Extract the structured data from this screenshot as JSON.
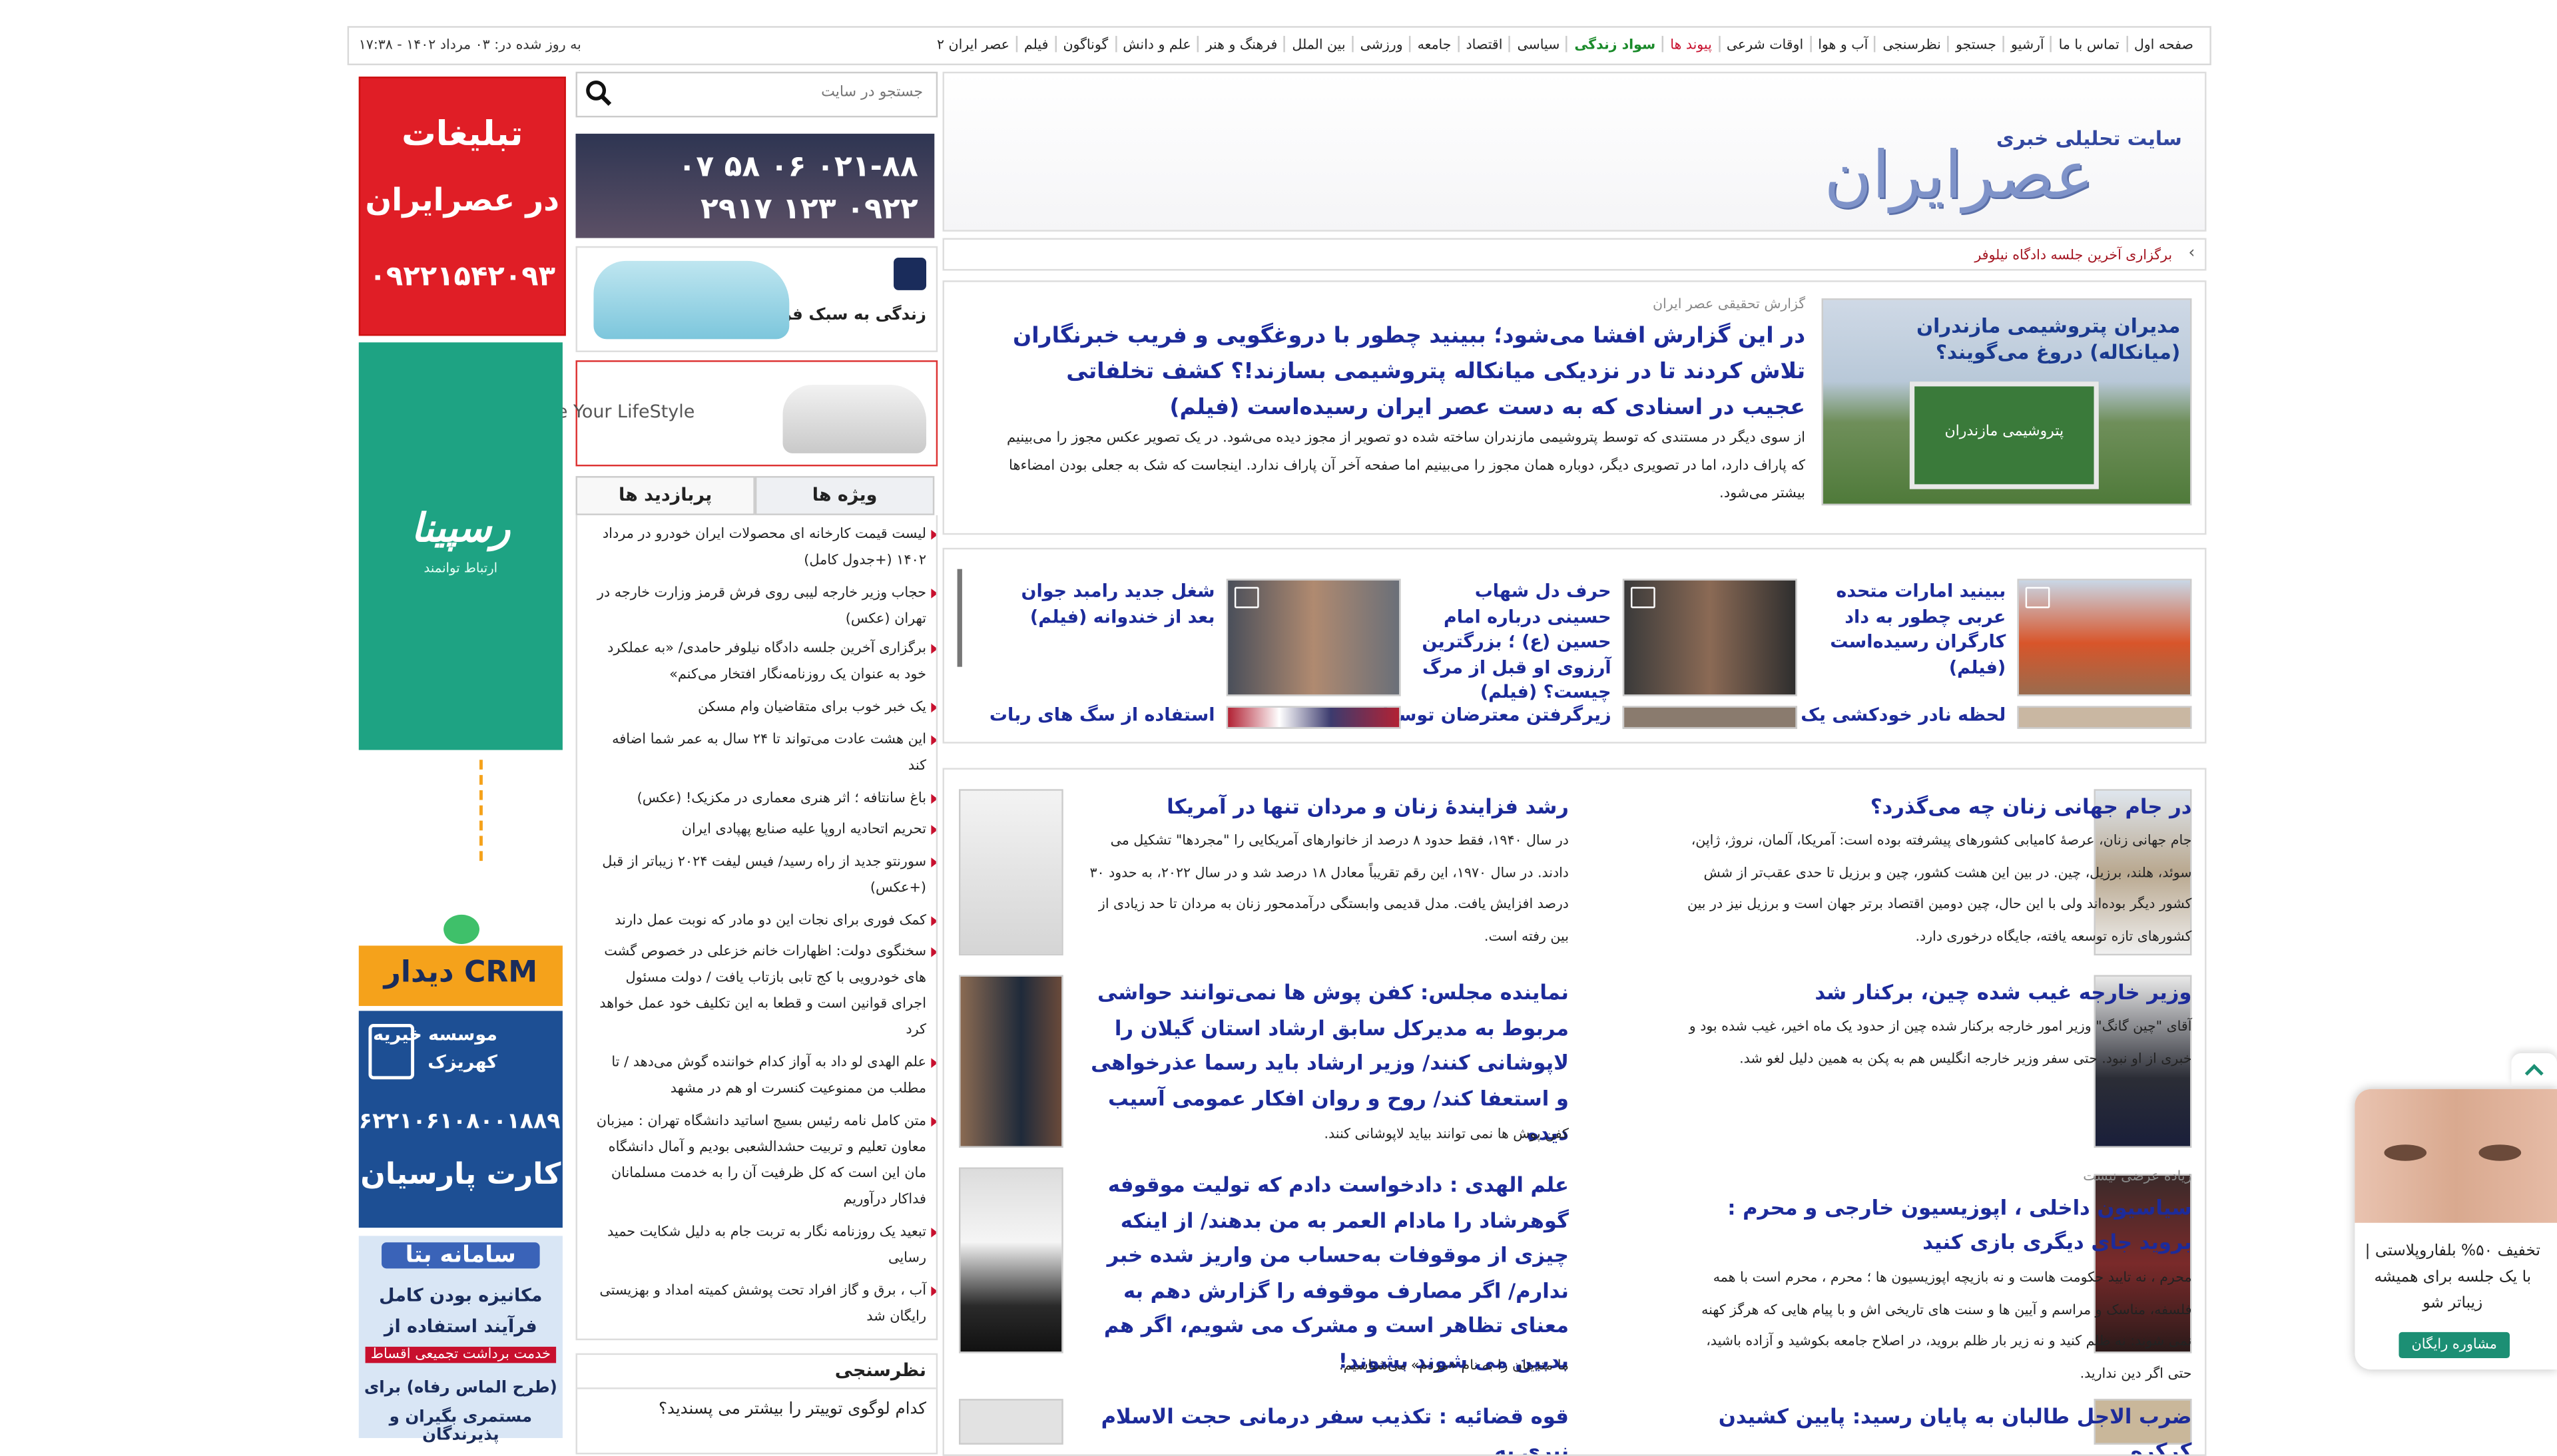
{
  "topbar": {
    "nav": [
      "صفحه اول",
      "تماس با ما",
      "آرشیو",
      "جستجو",
      "نظرسنجی",
      "آب و هوا",
      "اوقات شرعی",
      "پیوند ها",
      "سواد زندگی",
      "سیاسی",
      "اقتصاد",
      "جامعه",
      "ورزشی",
      "بین الملل",
      "فرهنگ و هنر",
      "علم و دانش",
      "گوناگون",
      "فیلم",
      "عصر ایران ۲"
    ],
    "updated": "به روز شده در: ۰۳ مرداد ۱۴۰۲ - ۱۷:۳۸"
  },
  "header": {
    "tagline": "سایت تحلیلی خبری",
    "logo": "عصرایران"
  },
  "ticker": {
    "text": "برگزاری آخرین جلسه دادگاه نیلوفر"
  },
  "lead": {
    "image_caption": "مدیران پتروشیمی مازندران (میانکاله) دروغ می‌گویند؟",
    "sign_text": "پتروشیمی مازندران",
    "kicker": "گزارش تحقیقی عصر ایران",
    "title": "در این گزارش افشا می‌شود؛ ببینید چطور با دروغگویی و فریب خبرنگاران تلاش کردند تا در نزدیکی میانکاله پتروشیمی بسازند!؟ کشف تخلفاتی عجیب در اسنادی که به دست عصر ایران رسیده‌است (فیلم)",
    "summary": "از سوی دیگر در مستندی که توسط پتروشیمی مازندران ساخته شده دو تصویر از مجوز دیده می‌شود. در یک تصویر عکس مجوز را می‌بینیم که پاراف دارد، اما در تصویری دیگر، دوباره همان مجوز را می‌بینیم اما صفحه آخر آن پاراف ندارد. اینجاست که شک به جعلی بودن امضاءها بیشتر می‌شود."
  },
  "videos": [
    {
      "title": "ببینید امارات متحده عربی چطور به داد کارگران رسیده‌است (فیلم)"
    },
    {
      "title": "حرف دل شهاب حسینی درباره امام حسین (ع) ؛ بزرگترین آرزوی او قبل از مرگ چیست؟ (فیلم)"
    },
    {
      "title": "شغل جدید رامبد جوان بعد از خندوانه (فیلم)"
    },
    {
      "title": "لحظه نادر خودکشی یک"
    },
    {
      "title": "زیرگرفتن معترضان توسط"
    },
    {
      "title": "استفاده از سگ های ربات"
    }
  ],
  "stories": [
    {
      "title": "در جام جهانی زنان چه می‌گذرد؟",
      "text": "جام جهانی زنان، عرصهٔ کامیابی کشورهای پیشرفته بوده است: آمریکا، آلمان، نروژ، ژاپن، سوئد، هلند، برزیل، چین. در بین این هشت کشور، چین و برزیل تا حدی عقب‌تر از شش کشور دیگر بوده‌اند ولی با این حال، چین دومین اقتصاد برتر جهان است و برزیل نیز در بین کشورهای تازه توسعه یافته، جایگاه درخوری دارد."
    },
    {
      "title": "رشد فزایندهٔ زنان و مردان تنها در آمریکا",
      "text": "در سال ۱۹۴۰، فقط حدود ۸ درصد از خانوارهای آمریکایی را \"مجردها\" تشکیل می دادند. در سال ۱۹۷۰، این رقم تقریباً معادل ۱۸ درصد شد و در سال ۲۰۲۲، به حدود ۳۰ درصد افزایش یافت. مدل قدیمی وابستگی درآمدمحور زنان به مردان تا حد زیادی از بین رفته است."
    },
    {
      "title": "وزیر خارجه غیب شده چین، برکنار شد",
      "text": "آقای \"چین گانگ\" وزیر امور خارجه برکنار شده چین از حدود یک ماه اخیر، غیب شده بود و خبری از او نبود. حتی سفر وزیر خارجه انگلیس هم به پکن به همین دلیل لغو شد."
    },
    {
      "title": "نماینده مجلس: کفن پوش ها نمی‌توانند حواشی مربوط به مدیرکل سابق ارشاد استان گیلان را لاپوشانی کنند/ وزیر ارشاد باید رسما عذرخواهی و استعفا کند/ روح و روان افکار عمومی آسیب دیده",
      "text": "کفن پوش ها نمی توانند بیاید لاپوشانی کنند."
    },
    {
      "kicker": "زیاده عرضی نیست",
      "title": "سیاسیون داخلی ، اپوزیسیون خارجی و محرم : بروید جای دیگری بازی کنید",
      "text": "محرم ، نه تایید حکومت هاست و نه بازیچه اپوزیسیون ها ؛ محرم ، محرم است با همه فلسفه، مناسک و مراسم و آیین ها و سنت های تاریخی اش و با پیام هایی که هرگز کهنه نمی شوند: نه ظلم کنید و نه زیر بار ظلم بروید، در اصلاح جامعه بکوشید و آزاده باشید، حتی اگر دین ندارید."
    },
    {
      "title": "علم الهدی : دادخواست دادم که تولیت موقوفه گوهرشاد را مادام العمر به من بدهند/ از اینکه چیزی از موقوفات به‌حساب من واریز شده خبر ندارم/ اگر مصارف موقوفه را گزارش دهم به معنای تظاهر است و مشرک می شویم، اگر هم بدبین می شوند بشوند!",
      "text": "ما متدینان را به نام «مردم» می‌شناسیم."
    },
    {
      "title": "ضرب الاجل طالبان به پایان رسید: پایین کشیدن کرکره"
    },
    {
      "title": "قوه قضائیه : تکذیب سفر درمانی حجت الاسلام نیری به"
    }
  ],
  "search": {
    "placeholder": "جستجو در سایت"
  },
  "banners": {
    "phone1": "۰۲۱-۸۸ ۰۶ ۵۸ ۰۷",
    "phone2": "۰۹۲۲ ۱۲۳ ۲۹۱۷",
    "car_slogan": "زندگی به سبک فردا",
    "life_slogan": "Redefine Your LifeStyle"
  },
  "tabs": {
    "special": "ویژه ها",
    "most_visited": "پربازدید ها"
  },
  "most_list": [
    "لیست قیمت کارخانه ای محصولات ایران خودرو در مرداد ۱۴۰۲ (+جدول کامل)",
    "حجاب وزیر خارجه لیبی روی فرش قرمز وزارت خارجه در تهران (عکس)",
    "برگزاری آخرین جلسه دادگاه نیلوفر حامدی/ «به عملکرد خود به عنوان یک روزنامه‌نگار افتخار می‌کنم»",
    "یک خبر خوب برای متقاضیان وام مسکن",
    "این هشت عادت می‌تواند تا ۲۴ سال به عمر شما اضافه کند",
    "باغ سانتافه ؛ اثر هنری معماری در مکزیک! (عکس)",
    "تحریم اتحادیه اروپا علیه صنایع پهپادی ایران",
    "سورنتو جدید از راه رسید/ فیس لیفت ۲۰۲۴ زیباتر از قبل (+عکس)",
    "کمک فوری برای نجات این دو مادر که نوبت عمل دارند",
    "سخنگوی دولت: اظهارات خانم خزعلی در خصوص گشت های خودرویی با کج تابی بازتاب یافت / دولت مسئول اجرای قوانین است و قطعا به این تکلیف خود عمل خواهد کرد",
    "علم الهدی لو داد به آواز کدام خواننده گوش می‌دهد / تا مطلب من ممنوعیت کنسرت او هم در مشهد",
    "متن کامل نامه رئیس بسیج اساتید دانشگاه تهران : میزبان معاون تعلیم و تربیت حشدالشعبی بودیم و آمال دانشگاه مان این است که کل ظرفیت آن را به خدمت مسلمانان فداکار درآوریم",
    "تبعید یک روزنامه نگار به تربت جام به دلیل شکایت حمید رسایی",
    "آب ، برق و گاز افراد تحت پوشش کمیته امداد و بهزیستی رایگان شد"
  ],
  "poll": {
    "heading": "نظرسنجی",
    "question": "کدام لوگوی توییتر را بیشتر می پسندید؟"
  },
  "ads": {
    "red_l1": "تبلیغات",
    "red_l2": "در عصرایران",
    "red_phone": "۰۹۲۲۱۵۴۲۰۹۳",
    "green_brand": "رسپینا",
    "green_sub": "ارتباط توانمند",
    "crm": "CRM دیدار",
    "charity_l1": "موسسه خیریه",
    "charity_l2": "کهریزک",
    "charity_card": "۶۲۲۱۰۶۱۰۸۰۰۱۸۸۹۰",
    "charity_l3": "کارت پارسیان",
    "betta_l1": "سامانه بتا",
    "betta_l2": "مکانیزه بودن کامل",
    "betta_l3": "فرآیند استفاده از",
    "betta_l4": "خدمت برداشت تجمیعی اقساط",
    "betta_l5": "(طرح الماس رفاه) برای",
    "betta_l6": "مستمری بگیران و پذیرندگان"
  },
  "promo": {
    "text": "تخفیف ۵۰% بلفاروپلاستی | با یک جلسه برای همیشه زیباتر شو",
    "button": "مشاوره رایگان"
  },
  "colors": {
    "headline": "#1d2b9a",
    "accent_red": "#c8102e",
    "ad_red": "#e01e26",
    "ad_green": "#1ea383",
    "promo_btn": "#1c8f74"
  }
}
